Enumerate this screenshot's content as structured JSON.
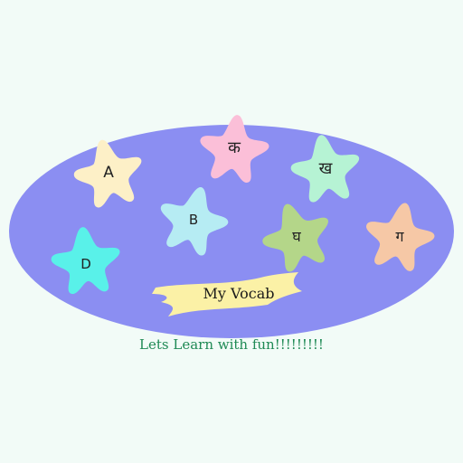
{
  "colors": {
    "background": "#f2fbf7",
    "oval": "#8b8ef2",
    "banner": "#fbf1a6",
    "tagline": "#1f8a55"
  },
  "stars": [
    {
      "label": "A",
      "color": "#fdf0c7"
    },
    {
      "label": "क",
      "color": "#fbbfd8"
    },
    {
      "label": "ख",
      "color": "#b6f3d4"
    },
    {
      "label": "B",
      "color": "#b6ecf3"
    },
    {
      "label": "घ",
      "color": "#b4d689"
    },
    {
      "label": "ग",
      "color": "#f6c8a6"
    },
    {
      "label": "D",
      "color": "#59f1e9"
    }
  ],
  "banner_label": "My Vocab",
  "tagline": "Lets Learn with fun!!!!!!!!!"
}
